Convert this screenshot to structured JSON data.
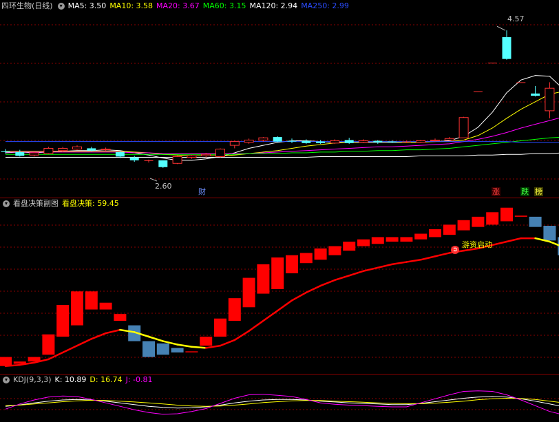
{
  "header1": {
    "title": "四环生物(日线)",
    "ma": [
      {
        "label": "MA5: 3.50",
        "color": "#ffffff"
      },
      {
        "label": "MA10: 3.58",
        "color": "#ffff00"
      },
      {
        "label": "MA20: 3.67",
        "color": "#ff00ff"
      },
      {
        "label": "MA60: 3.15",
        "color": "#00ff00"
      },
      {
        "label": "MA120: 2.94",
        "color": "#ffffff"
      },
      {
        "label": "MA250: 2.99",
        "color": "#2a4cff"
      }
    ]
  },
  "header2": {
    "title": "看盘决策副图",
    "value_label": "看盘决策: 59.45"
  },
  "header3": {
    "title": "KDJ(9,3,3)",
    "k_label": "K: 10.89",
    "d_label": "D: 16.74",
    "j_label": "J: -0.81"
  },
  "annotations": {
    "high_label": "4.57",
    "low_label": "2.60",
    "cai_tag": "财",
    "zhang_tag": "涨",
    "die_tag": "跌",
    "bang_tag": "榜",
    "start_label": "游资启动"
  },
  "colors": {
    "up": "#ff3232",
    "down": "#54ffff",
    "decision_up": "#ff0000",
    "decision_down": "#4682b4",
    "ma5": "#ffffff",
    "ma10": "#ffff00",
    "ma20": "#ff00ff",
    "ma60": "#00ff00",
    "ma120": "#ffffff",
    "ma250": "#2a4cff",
    "kdj_k": "#ffffff",
    "kdj_d": "#ffff00",
    "kdj_j": "#ff00ff"
  },
  "chart_data": [
    {
      "type": "candlestick",
      "title": "四环生物(日线)",
      "ylim": [
        2.5,
        4.7
      ],
      "high_marker": 4.57,
      "low_marker": 2.6,
      "candles": [
        {
          "o": 2.96,
          "h": 2.99,
          "l": 2.93,
          "c": 2.95
        },
        {
          "o": 2.95,
          "h": 2.98,
          "l": 2.89,
          "c": 2.9
        },
        {
          "o": 2.91,
          "h": 2.95,
          "l": 2.89,
          "c": 2.94
        },
        {
          "o": 2.93,
          "h": 3.02,
          "l": 2.92,
          "c": 3.0
        },
        {
          "o": 2.97,
          "h": 3.02,
          "l": 2.95,
          "c": 3.0
        },
        {
          "o": 2.99,
          "h": 3.04,
          "l": 2.98,
          "c": 3.02
        },
        {
          "o": 3.0,
          "h": 3.02,
          "l": 2.96,
          "c": 2.97
        },
        {
          "o": 2.98,
          "h": 3.01,
          "l": 2.96,
          "c": 2.99
        },
        {
          "o": 2.95,
          "h": 2.96,
          "l": 2.87,
          "c": 2.89
        },
        {
          "o": 2.88,
          "h": 2.9,
          "l": 2.82,
          "c": 2.84
        },
        {
          "o": 2.84,
          "h": 2.85,
          "l": 2.81,
          "c": 2.84
        },
        {
          "o": 2.84,
          "h": 2.84,
          "l": 2.74,
          "c": 2.75
        },
        {
          "o": 2.8,
          "h": 2.9,
          "l": 2.79,
          "c": 2.89
        },
        {
          "o": 2.88,
          "h": 2.91,
          "l": 2.86,
          "c": 2.9
        },
        {
          "o": 2.9,
          "h": 2.94,
          "l": 2.88,
          "c": 2.92
        },
        {
          "o": 2.89,
          "h": 3.0,
          "l": 2.88,
          "c": 2.99
        },
        {
          "o": 3.04,
          "h": 3.1,
          "l": 3.0,
          "c": 3.09
        },
        {
          "o": 3.08,
          "h": 3.13,
          "l": 3.06,
          "c": 3.11
        },
        {
          "o": 3.11,
          "h": 3.15,
          "l": 3.09,
          "c": 3.14
        },
        {
          "o": 3.15,
          "h": 3.16,
          "l": 3.08,
          "c": 3.09
        },
        {
          "o": 3.1,
          "h": 3.13,
          "l": 3.07,
          "c": 3.09
        },
        {
          "o": 3.1,
          "h": 3.12,
          "l": 3.06,
          "c": 3.07
        },
        {
          "o": 3.09,
          "h": 3.11,
          "l": 3.06,
          "c": 3.07
        },
        {
          "o": 3.07,
          "h": 3.12,
          "l": 3.06,
          "c": 3.1
        },
        {
          "o": 3.11,
          "h": 3.14,
          "l": 3.06,
          "c": 3.07
        },
        {
          "o": 3.08,
          "h": 3.12,
          "l": 3.07,
          "c": 3.1
        },
        {
          "o": 3.1,
          "h": 3.11,
          "l": 3.06,
          "c": 3.08
        },
        {
          "o": 3.09,
          "h": 3.11,
          "l": 3.07,
          "c": 3.08
        },
        {
          "o": 3.09,
          "h": 3.1,
          "l": 3.07,
          "c": 3.09
        },
        {
          "o": 3.08,
          "h": 3.11,
          "l": 3.07,
          "c": 3.1
        },
        {
          "o": 3.1,
          "h": 3.13,
          "l": 3.09,
          "c": 3.11
        },
        {
          "o": 3.11,
          "h": 3.15,
          "l": 3.1,
          "c": 3.13
        },
        {
          "o": 3.14,
          "h": 3.42,
          "l": 3.14,
          "c": 3.41
        },
        {
          "o": 3.76,
          "h": 3.76,
          "l": 3.76,
          "c": 3.76
        },
        {
          "o": 4.14,
          "h": 4.14,
          "l": 4.14,
          "c": 4.14
        },
        {
          "o": 4.48,
          "h": 4.57,
          "l": 4.18,
          "c": 4.19
        },
        {
          "o": 3.88,
          "h": 3.88,
          "l": 3.88,
          "c": 3.88
        },
        {
          "o": 3.73,
          "h": 3.83,
          "l": 3.69,
          "c": 3.7
        },
        {
          "o": 3.5,
          "h": 3.88,
          "l": 3.4,
          "c": 3.8
        },
        {
          "o": 3.64,
          "h": 3.7,
          "l": 3.6,
          "c": 3.62
        }
      ],
      "series": [
        {
          "name": "MA5",
          "values": [
            2.94,
            2.95,
            2.94,
            2.95,
            2.96,
            2.97,
            2.97,
            2.98,
            2.97,
            2.94,
            2.91,
            2.87,
            2.84,
            2.84,
            2.86,
            2.89,
            2.94,
            3.0,
            3.04,
            3.08,
            3.1,
            3.1,
            3.09,
            3.08,
            3.08,
            3.08,
            3.08,
            3.08,
            3.08,
            3.09,
            3.09,
            3.1,
            3.16,
            3.28,
            3.48,
            3.74,
            3.91,
            3.97,
            3.96,
            3.78
          ]
        },
        {
          "name": "MA10",
          "values": [
            2.96,
            2.96,
            2.96,
            2.96,
            2.96,
            2.96,
            2.96,
            2.96,
            2.96,
            2.95,
            2.94,
            2.92,
            2.91,
            2.9,
            2.9,
            2.9,
            2.91,
            2.93,
            2.95,
            2.97,
            3.0,
            3.03,
            3.05,
            3.07,
            3.08,
            3.09,
            3.09,
            3.09,
            3.08,
            3.08,
            3.09,
            3.09,
            3.11,
            3.17,
            3.27,
            3.4,
            3.52,
            3.62,
            3.72,
            3.76
          ]
        },
        {
          "name": "MA20",
          "values": [
            2.95,
            2.95,
            2.95,
            2.95,
            2.95,
            2.95,
            2.95,
            2.95,
            2.95,
            2.94,
            2.94,
            2.93,
            2.93,
            2.93,
            2.93,
            2.93,
            2.93,
            2.93,
            2.94,
            2.95,
            2.96,
            2.97,
            2.98,
            2.99,
            3.0,
            3.01,
            3.02,
            3.02,
            3.03,
            3.04,
            3.05,
            3.06,
            3.09,
            3.12,
            3.16,
            3.21,
            3.27,
            3.32,
            3.37,
            3.42
          ]
        },
        {
          "name": "MA60",
          "values": [
            2.92,
            2.92,
            2.92,
            2.92,
            2.92,
            2.92,
            2.92,
            2.92,
            2.92,
            2.92,
            2.92,
            2.92,
            2.92,
            2.92,
            2.92,
            2.92,
            2.92,
            2.93,
            2.93,
            2.93,
            2.94,
            2.94,
            2.95,
            2.95,
            2.96,
            2.96,
            2.97,
            2.97,
            2.98,
            2.98,
            2.99,
            3.0,
            3.02,
            3.04,
            3.06,
            3.08,
            3.1,
            3.12,
            3.14,
            3.15
          ]
        },
        {
          "name": "MA120",
          "values": [
            2.88,
            2.88,
            2.88,
            2.88,
            2.88,
            2.88,
            2.88,
            2.88,
            2.88,
            2.88,
            2.88,
            2.88,
            2.88,
            2.88,
            2.88,
            2.88,
            2.88,
            2.88,
            2.88,
            2.88,
            2.88,
            2.88,
            2.89,
            2.89,
            2.89,
            2.89,
            2.89,
            2.89,
            2.89,
            2.9,
            2.9,
            2.9,
            2.9,
            2.91,
            2.91,
            2.92,
            2.92,
            2.93,
            2.93,
            2.94
          ]
        },
        {
          "name": "MA250",
          "values": [
            3.09,
            3.09,
            3.09,
            3.09,
            3.09,
            3.09,
            3.09,
            3.09,
            3.09,
            3.09,
            3.09,
            3.09,
            3.09,
            3.09,
            3.09,
            3.09,
            3.09,
            3.09,
            3.09,
            3.09,
            3.09,
            3.09,
            3.09,
            3.09,
            3.09,
            3.09,
            3.09,
            3.09,
            3.09,
            3.09,
            3.09,
            3.09,
            3.09,
            3.09,
            3.09,
            3.09,
            3.08,
            3.08,
            3.08,
            3.08
          ]
        }
      ]
    },
    {
      "type": "bar",
      "title": "看盘决策副图",
      "ylim": [
        0,
        100
      ],
      "bars": [
        {
          "o": 2,
          "c": 10
        },
        {
          "o": 4,
          "c": 6
        },
        {
          "o": 6,
          "c": 10
        },
        {
          "o": 12,
          "c": 30
        },
        {
          "o": 28,
          "c": 56
        },
        {
          "o": 38,
          "c": 68
        },
        {
          "o": 52,
          "c": 68
        },
        {
          "o": 52,
          "c": 58
        },
        {
          "o": 42,
          "c": 48
        },
        {
          "o": 38,
          "c": 24
        },
        {
          "o": 24,
          "c": 10
        },
        {
          "o": 22,
          "c": 12
        },
        {
          "o": 18,
          "c": 14
        },
        {
          "o": 15,
          "c": 15
        },
        {
          "o": 20,
          "c": 28
        },
        {
          "o": 28,
          "c": 44
        },
        {
          "o": 42,
          "c": 62
        },
        {
          "o": 54,
          "c": 80
        },
        {
          "o": 66,
          "c": 92
        },
        {
          "o": 70,
          "c": 98
        },
        {
          "o": 84,
          "c": 100
        },
        {
          "o": 93,
          "c": 102
        },
        {
          "o": 96,
          "c": 106
        },
        {
          "o": 100,
          "c": 108
        },
        {
          "o": 104,
          "c": 112
        },
        {
          "o": 108,
          "c": 114
        },
        {
          "o": 110,
          "c": 116
        },
        {
          "o": 112,
          "c": 116
        },
        {
          "o": 112,
          "c": 116
        },
        {
          "o": 114,
          "c": 119
        },
        {
          "o": 116,
          "c": 123
        },
        {
          "o": 118,
          "c": 127
        },
        {
          "o": 122,
          "c": 131
        },
        {
          "o": 125,
          "c": 134
        },
        {
          "o": 127,
          "c": 138
        },
        {
          "o": 130,
          "c": 142
        },
        {
          "o": 134,
          "c": 135
        },
        {
          "o": 134,
          "c": 125
        },
        {
          "o": 126,
          "c": 113
        },
        {
          "o": 116,
          "c": 100
        }
      ],
      "line": [
        2,
        3,
        5,
        8,
        14,
        20,
        26,
        31,
        34,
        32,
        28,
        24,
        21,
        19,
        18,
        20,
        25,
        33,
        42,
        51,
        60,
        67,
        73,
        78,
        82,
        86,
        89,
        92,
        94,
        96,
        99,
        102,
        104,
        106,
        109,
        112,
        115,
        115,
        112,
        107
      ]
    },
    {
      "type": "line",
      "title": "KDJ(9,3,3)",
      "ylim": [
        -10,
        110
      ],
      "series": [
        {
          "name": "K",
          "values": [
            40,
            45,
            52,
            58,
            62,
            64,
            62,
            58,
            52,
            46,
            40,
            36,
            34,
            35,
            38,
            44,
            52,
            58,
            62,
            64,
            64,
            62,
            58,
            55,
            52,
            50,
            48,
            46,
            46,
            50,
            56,
            62,
            68,
            72,
            74,
            72,
            66,
            58,
            48,
            38
          ]
        },
        {
          "name": "D",
          "values": [
            42,
            44,
            48,
            52,
            56,
            59,
            61,
            60,
            58,
            55,
            52,
            48,
            44,
            41,
            40,
            41,
            44,
            48,
            53,
            56,
            59,
            60,
            60,
            58,
            56,
            54,
            52,
            50,
            49,
            49,
            51,
            54,
            58,
            63,
            66,
            68,
            67,
            64,
            58,
            52
          ]
        },
        {
          "name": "J",
          "values": [
            30,
            48,
            62,
            72,
            76,
            74,
            64,
            52,
            40,
            28,
            18,
            12,
            14,
            22,
            32,
            50,
            68,
            80,
            82,
            78,
            74,
            64,
            52,
            47,
            44,
            42,
            40,
            38,
            38,
            52,
            66,
            80,
            92,
            94,
            92,
            80,
            62,
            42,
            22,
            10
          ]
        }
      ]
    }
  ]
}
